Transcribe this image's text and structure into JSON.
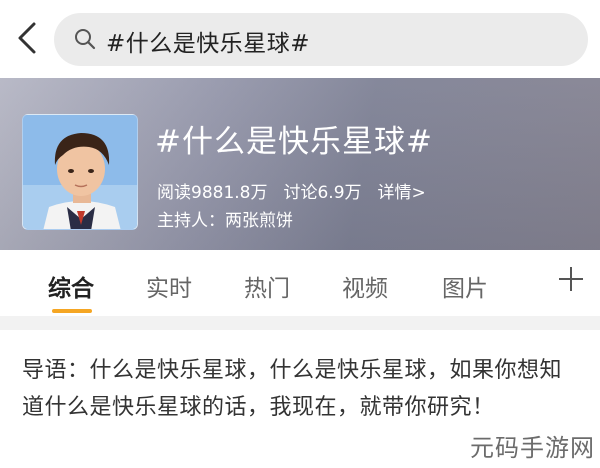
{
  "search": {
    "query": "#什么是快乐星球#"
  },
  "topic": {
    "title": "#什么是快乐星球#",
    "reads": "阅读9881.8万",
    "discussions": "讨论6.9万",
    "details_label": "详情>",
    "host": "主持人：两张煎饼"
  },
  "tabs": [
    {
      "label": "综合"
    },
    {
      "label": "实时"
    },
    {
      "label": "热门"
    },
    {
      "label": "视频"
    },
    {
      "label": "图片"
    }
  ],
  "article": {
    "text": "导语：什么是快乐星球，什么是快乐星球，如果你想知道什么是快乐星球的话，我现在，就带你研究！"
  },
  "watermark": {
    "text": "元码手游网"
  },
  "colors": {
    "accent": "#f5a623",
    "search_bg": "#ebebeb",
    "banner": "#8f90a4"
  },
  "icons": {
    "back": "back-chevron-icon",
    "search": "search-icon",
    "add": "plus-icon"
  }
}
